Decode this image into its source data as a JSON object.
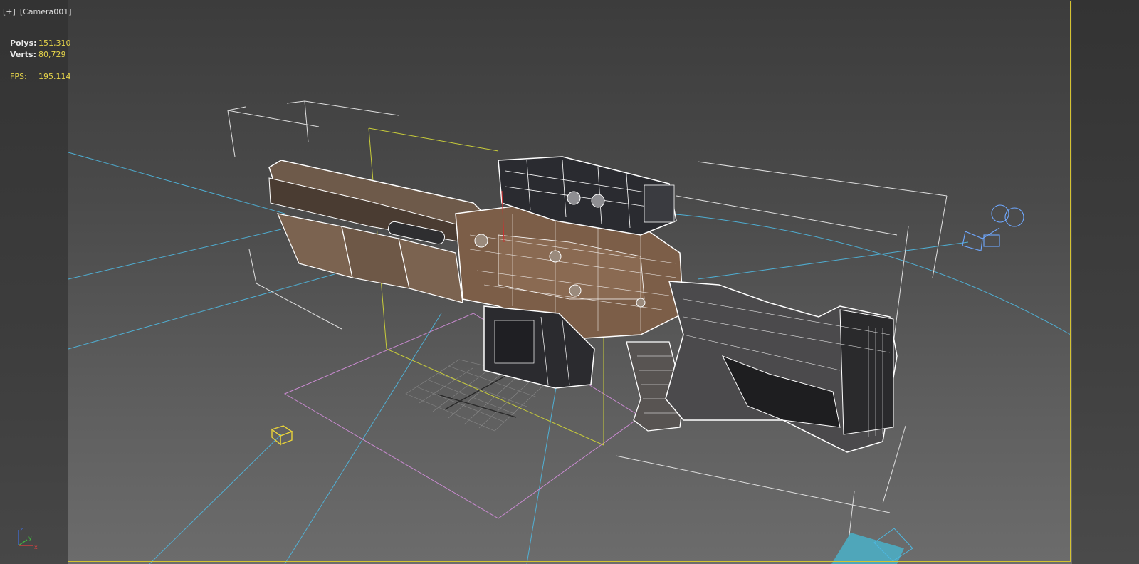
{
  "viewport": {
    "menu_label": "[+]",
    "camera_label": "[Camera001]"
  },
  "stats": {
    "polys_label": "Polys:",
    "polys_value": "151,310",
    "verts_label": "Verts:",
    "verts_value": "80,729",
    "fps_label": "FPS:",
    "fps_value": "195.114"
  },
  "axis_gizmo": {
    "x": "x",
    "y": "y",
    "z": "z"
  },
  "colors": {
    "frame": "#d4c232",
    "light_lines": "#4fb8e0",
    "wire": "#ffffff",
    "model_fill": "#7a5c46",
    "grid_selection": "#c98ad0",
    "bbox_yellow": "#c8cc3a"
  },
  "icons": {
    "camera": "camera-icon",
    "light": "light-helper-icon",
    "cube": "dummy-cube-icon",
    "grid": "home-grid-icon"
  }
}
